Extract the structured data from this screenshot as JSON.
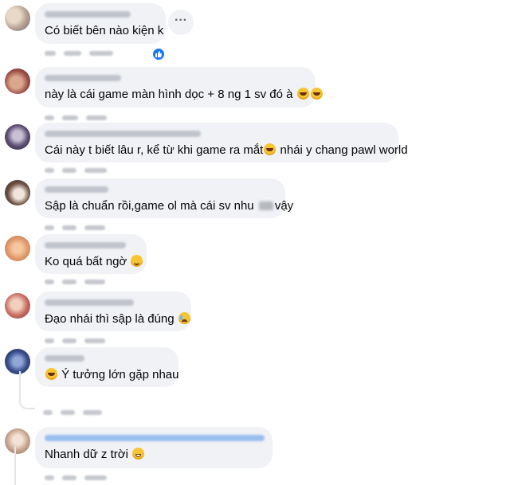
{
  "comments": [
    {
      "text": "Có biết bên nào kiện k"
    },
    {
      "text": "này là cái game màn hình dọc + 8 ng 1 sv đó à"
    },
    {
      "text_before": "Cái này t biết lâu r, kể từ khi game ra mắt",
      "text_after": " nhái y chang pawl world"
    },
    {
      "text_before": "Sập là chuẩn rồi,game ol mà cái sv nhu ",
      "text_after": "vậy"
    },
    {
      "text": "Ko quá bất ngờ "
    },
    {
      "text": "Đạo nhái thì sập là đúng "
    },
    {
      "text": " Ý tưởng lớn gặp nhau"
    },
    {
      "text": "Nhanh dữ z trời "
    }
  ],
  "more_button": {
    "label": "···"
  },
  "icons": {
    "like_badge": "thumbs-up-icon",
    "more": "more-options-icon",
    "emoji_rofl": "rofl-emoji-icon",
    "emoji_smile": "smile-emoji-icon",
    "emoji_cry": "crying-emoji-icon",
    "emoji_sweat": "grin-sweat-emoji-icon"
  },
  "colors": {
    "bubble": "#f0f2f5",
    "like_blue": "#1877f2",
    "text": "#050505"
  }
}
